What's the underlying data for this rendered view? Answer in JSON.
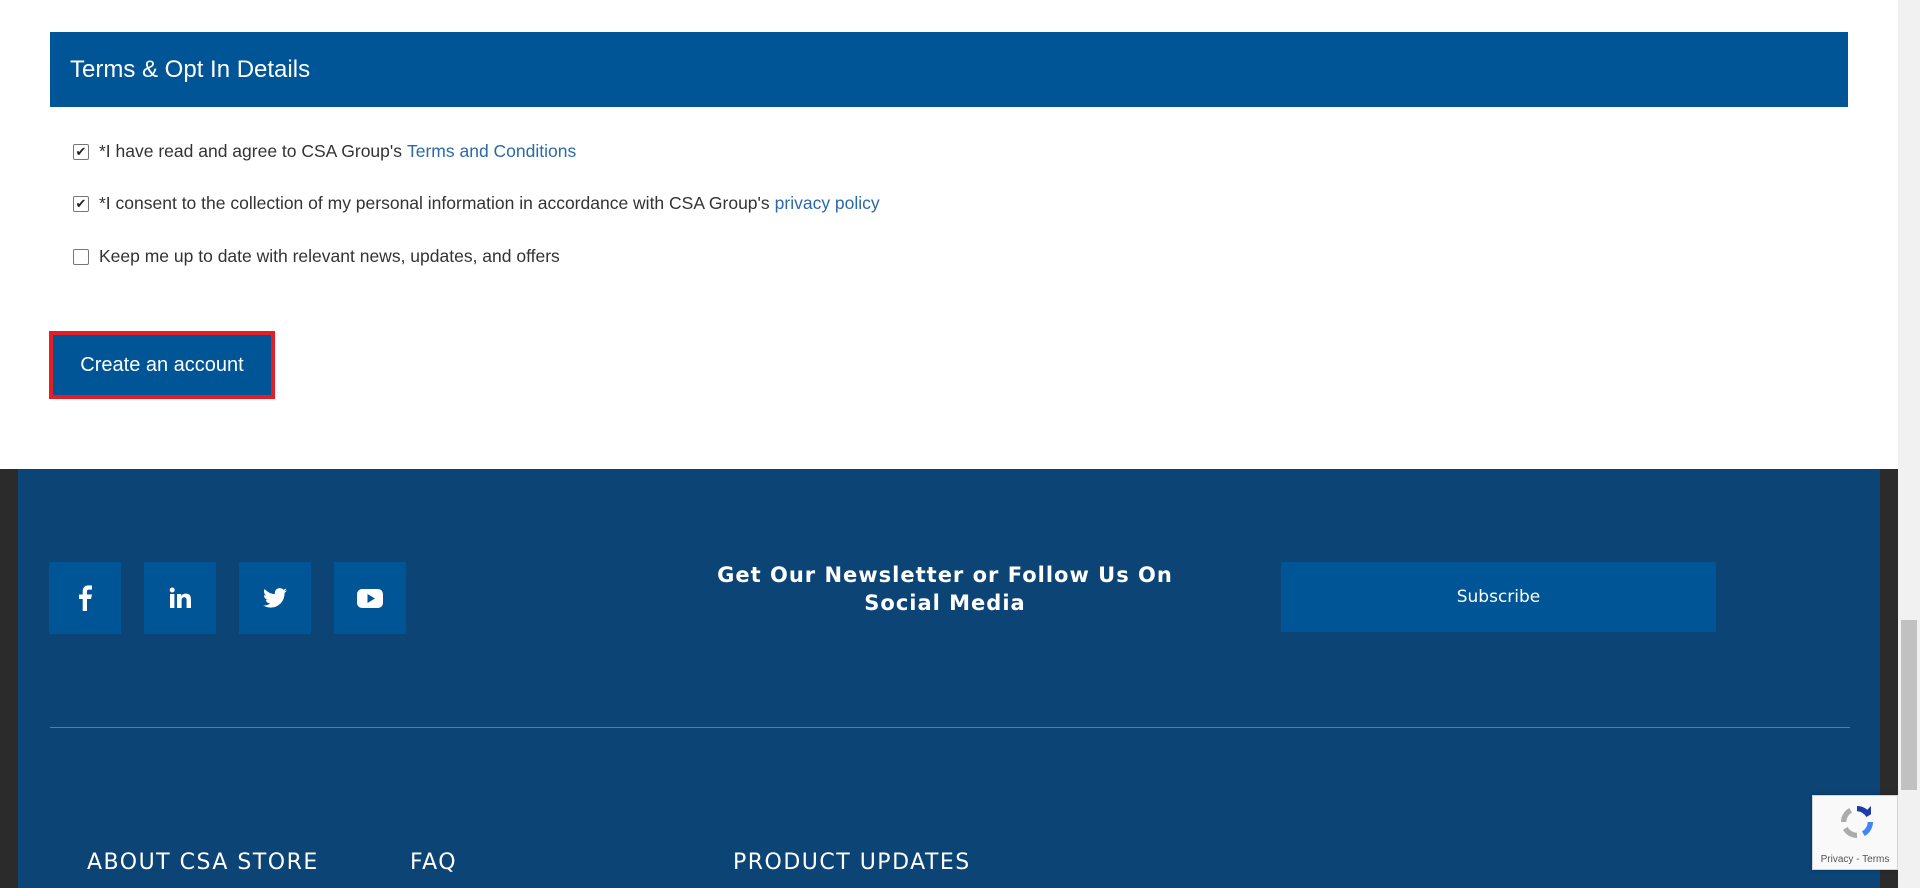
{
  "terms": {
    "title": "Terms & Opt In Details",
    "items": [
      {
        "text": "*I have read and agree to CSA Group's ",
        "link": "Terms and Conditions",
        "checked": true
      },
      {
        "text": "*I consent to the collection of my personal information in accordance with CSA Group's ",
        "link": "privacy policy",
        "checked": true
      },
      {
        "text": "Keep me up to date with relevant news, updates, and offers",
        "link": "",
        "checked": false
      }
    ],
    "create_button": "Create an account"
  },
  "footer": {
    "social_icons": [
      "facebook-icon",
      "linkedin-icon",
      "twitter-icon",
      "youtube-icon"
    ],
    "newsletter_title": "Get Our Newsletter or Follow Us On Social Media",
    "subscribe_label": "Subscribe",
    "links": [
      "ABOUT CSA STORE",
      "FAQ",
      "PRODUCT UPDATES"
    ]
  },
  "recaptcha": {
    "text": "Privacy - Terms"
  },
  "colors": {
    "primary": "#005596",
    "footer_bg": "#0b4475",
    "highlight": "#e41e26",
    "link": "#2a6aa8"
  }
}
